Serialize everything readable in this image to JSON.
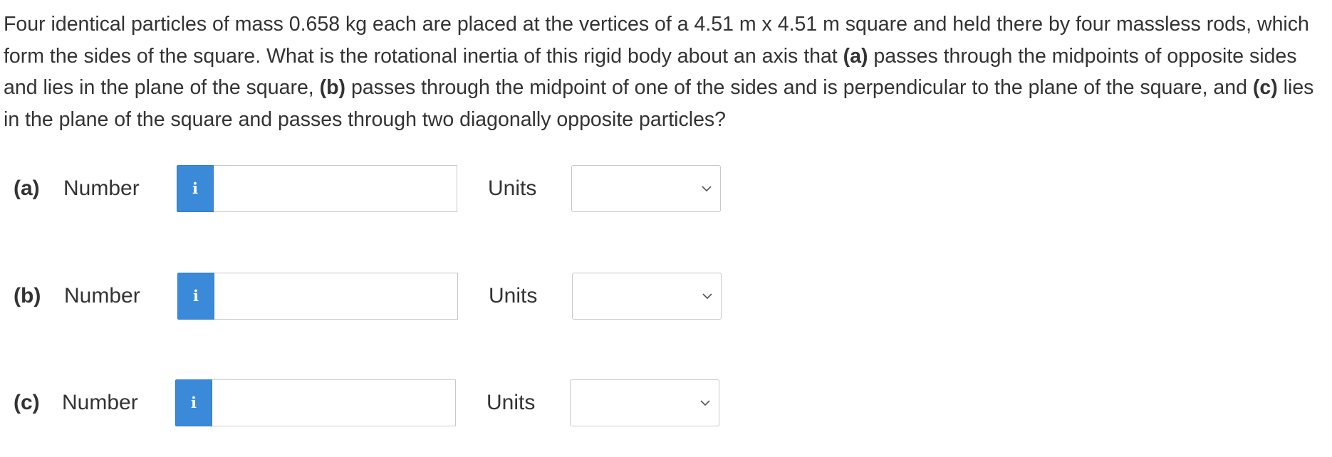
{
  "question": {
    "text_1": "Four identical particles of mass 0.658 kg each are placed at the vertices of a 4.51 m x 4.51 m square and held there by four massless rods, which form the sides of the square. What is the rotational inertia of this rigid body about an axis that ",
    "part_a_marker": "(a)",
    "text_2": " passes through the midpoints of opposite sides and lies in the plane of the square, ",
    "part_b_marker": "(b)",
    "text_3": " passes through the midpoint of one of the sides and is perpendicular to the plane of the square, and ",
    "part_c_marker": "(c)",
    "text_4": " lies in the plane of the square and passes through two diagonally opposite particles?"
  },
  "parts": [
    {
      "label": "(a)",
      "number_label": "Number",
      "info_icon": "i",
      "number_value": "",
      "units_label": "Units",
      "units_selected": ""
    },
    {
      "label": "(b)",
      "number_label": "Number",
      "info_icon": "i",
      "number_value": "",
      "units_label": "Units",
      "units_selected": ""
    },
    {
      "label": "(c)",
      "number_label": "Number",
      "info_icon": "i",
      "number_value": "",
      "units_label": "Units",
      "units_selected": ""
    }
  ],
  "colors": {
    "info_button": "#3b8ad9",
    "text": "#333333",
    "border": "#c8c8c8"
  },
  "icons": {
    "info": "info-icon",
    "dropdown": "chevron-down-icon"
  }
}
